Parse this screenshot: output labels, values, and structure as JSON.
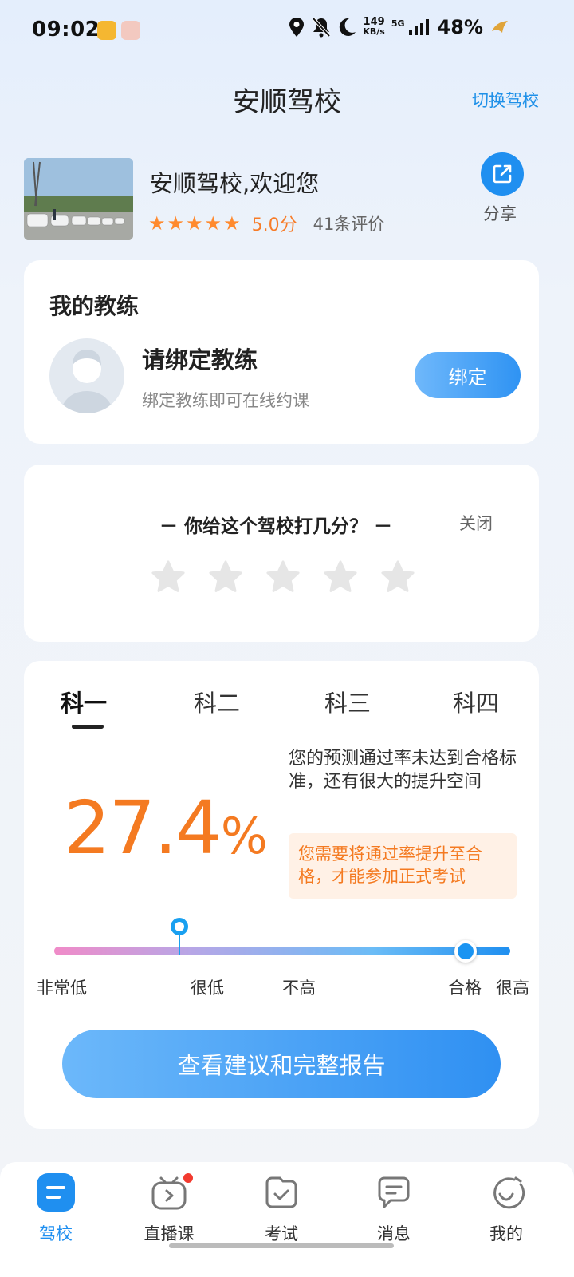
{
  "status_bar": {
    "time": "09:02",
    "net_speed_top": "149",
    "net_speed_bottom": "KB/s",
    "network": "5G",
    "battery": "48%",
    "icons": [
      "location-icon",
      "bell-off-icon",
      "moon-icon",
      "signal-icon"
    ]
  },
  "header": {
    "title": "安顺驾校",
    "switch_label": "切换驾校"
  },
  "school": {
    "name": "安顺驾校,欢迎您",
    "rating": 5,
    "score": "5.0分",
    "reviews": "41条评价",
    "share_label": "分享"
  },
  "coach": {
    "section_title": "我的教练",
    "bind_title": "请绑定教练",
    "bind_subtitle": "绑定教练即可在线约课",
    "bind_button": "绑定"
  },
  "rating_card": {
    "question": "－ 你给这个驾校打几分？ －",
    "close_label": "关闭",
    "stars": 5,
    "selected": 0
  },
  "exam": {
    "tabs": [
      "科一",
      "科二",
      "科三",
      "科四"
    ],
    "active_tab": 0,
    "pass_rate": "27.4",
    "pass_rate_unit": "%",
    "message": "您的预测通过率未达到合格标准，还有很大的提升空间",
    "note": "您需要将通过率提升至合格，才能参加正式考试",
    "levels": [
      "非常低",
      "很低",
      "不高",
      "合格",
      "很高"
    ],
    "report_button": "查看建议和完整报告"
  },
  "bottom_nav": {
    "items": [
      {
        "label": "驾校",
        "icon": "school-icon",
        "active": true
      },
      {
        "label": "直播课",
        "icon": "live-tv-icon",
        "badge": true
      },
      {
        "label": "考试",
        "icon": "exam-icon"
      },
      {
        "label": "消息",
        "icon": "message-icon"
      },
      {
        "label": "我的",
        "icon": "profile-icon"
      }
    ]
  },
  "colors": {
    "accent": "#1f8ff0",
    "orange": "#f47a21",
    "star": "#ff8a2e"
  }
}
